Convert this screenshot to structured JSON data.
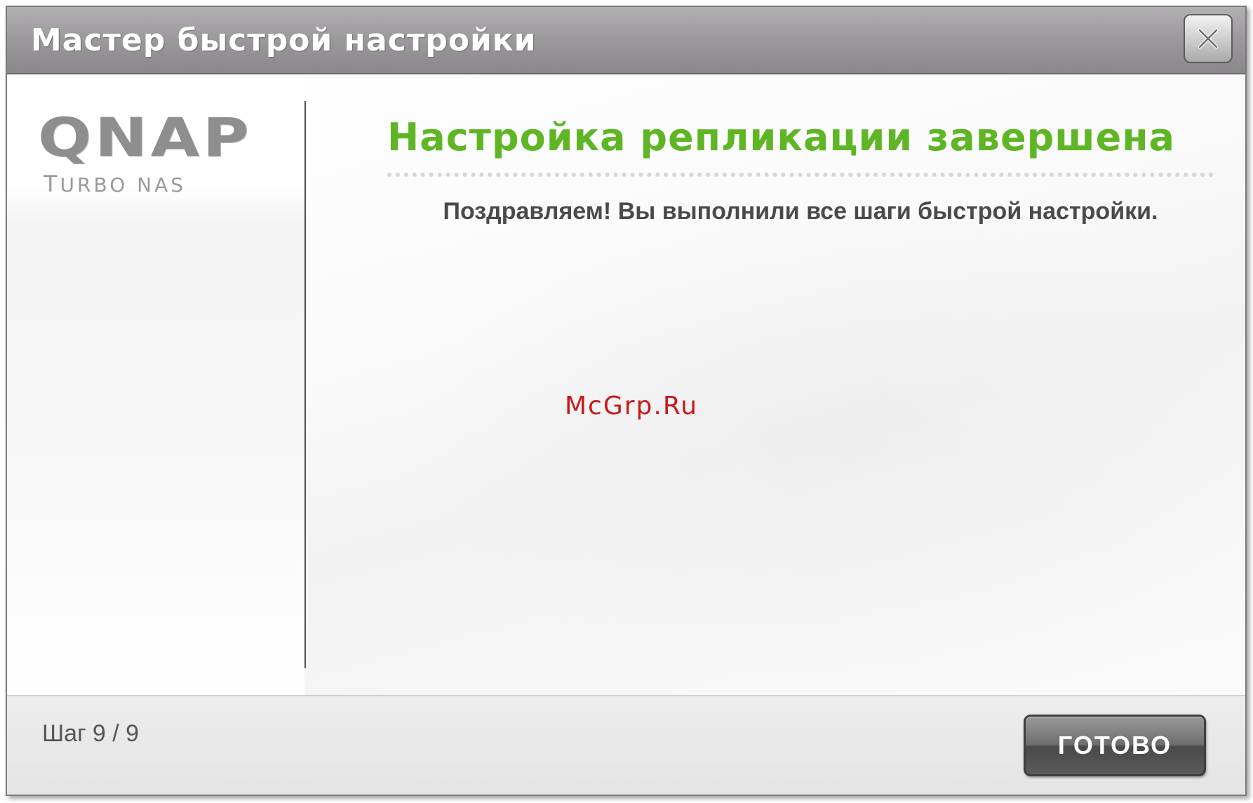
{
  "window": {
    "title": "Мастер быстрой настройки",
    "close_icon": "close-icon"
  },
  "logo": {
    "main": "QNAP",
    "sub_first": "T",
    "sub_rest": "URBO NAS"
  },
  "main": {
    "heading": "Настройка репликации завершена",
    "message": "Поздравляем! Вы выполнили все шаги быстрой настройки.",
    "watermark": "McGrp.Ru"
  },
  "footer": {
    "step": "Шаг 9 / 9",
    "done_label": "ГОТОВО"
  },
  "colors": {
    "heading": "#5fb624",
    "watermark": "#c8191c",
    "titlebar": "#9d9a9e"
  }
}
